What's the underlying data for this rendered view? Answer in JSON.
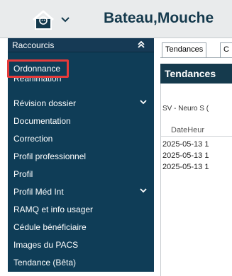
{
  "header": {
    "patient_name": "Bateau,Mouche",
    "home_icon": "home-person-icon",
    "dropdown_icon": "chevron-down-icon"
  },
  "sidebar": {
    "header_label": "Raccourcis",
    "collapse_icon": "double-chevron-up-icon",
    "items": [
      {
        "label": "Ordonnance",
        "highlighted": true
      },
      {
        "label": "Réanimation",
        "partially_hidden": true
      },
      {
        "label": "Révision dossier",
        "has_submenu": true
      },
      {
        "label": "Documentation"
      },
      {
        "label": "Correction"
      },
      {
        "label": "Profil professionnel"
      },
      {
        "label": "Profil"
      },
      {
        "label": "Profil Méd Int",
        "has_submenu": true
      },
      {
        "label": "RAMQ et info usager"
      },
      {
        "label": "Cédule bénéficiaire"
      },
      {
        "label": "Images du PACS"
      },
      {
        "label": "Tendance (Bêta)"
      }
    ]
  },
  "tabs": [
    {
      "label": "Tendances",
      "active": true
    },
    {
      "label": "C"
    }
  ],
  "panel": {
    "title": "Tendances",
    "section_title": "SV - Neuro S (",
    "column_header": "DateHeur",
    "rows": [
      "2025-05-13 1",
      "2025-05-13 1",
      "2025-05-13 1"
    ]
  },
  "colors": {
    "sidebar_bg": "#0f3d57",
    "header_text": "#153a4d",
    "highlight_border": "#e63a3a"
  }
}
